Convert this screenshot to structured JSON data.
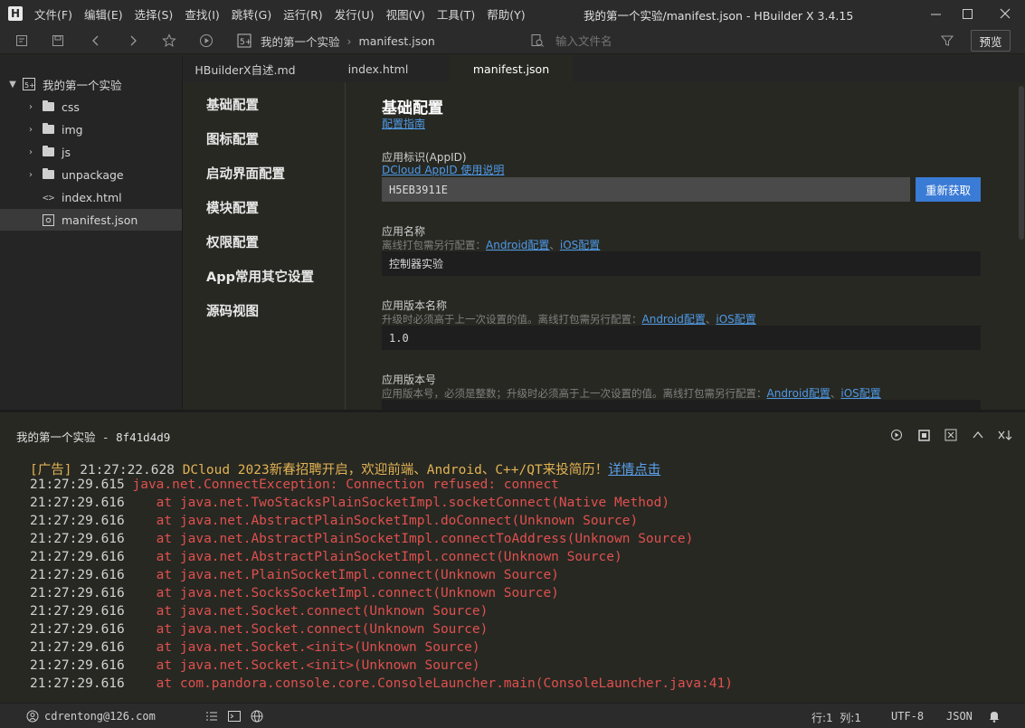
{
  "app": {
    "logo_letter": "H",
    "window_title": "我的第一个实验/manifest.json - HBuilder X 3.4.15",
    "menu": [
      "文件(F)",
      "编辑(E)",
      "选择(S)",
      "查找(I)",
      "跳转(G)",
      "运行(R)",
      "发行(U)",
      "视图(V)",
      "工具(T)",
      "帮助(Y)"
    ]
  },
  "toolbar": {
    "breadcrumb_project": "我的第一个实验",
    "breadcrumb_file": "manifest.json",
    "file_search_placeholder": "输入文件名",
    "preview_label": "预览"
  },
  "sidebar": {
    "project_name": "我的第一个实验",
    "items": [
      {
        "label": "css",
        "type": "folder"
      },
      {
        "label": "img",
        "type": "folder"
      },
      {
        "label": "js",
        "type": "folder"
      },
      {
        "label": "unpackage",
        "type": "folder"
      },
      {
        "label": "index.html",
        "type": "file"
      },
      {
        "label": "manifest.json",
        "type": "file",
        "selected": true
      }
    ]
  },
  "tabs": [
    {
      "label": "HBuilderX自述.md"
    },
    {
      "label": "index.html"
    },
    {
      "label": "manifest.json",
      "active": true
    }
  ],
  "config_nav": [
    "基础配置",
    "图标配置",
    "启动界面配置",
    "模块配置",
    "权限配置",
    "App常用其它设置",
    "源码视图"
  ],
  "form": {
    "title": "基础配置",
    "guide_link": "配置指南",
    "appid_label": "应用标识(AppID)",
    "appid_link": "DCloud AppID 使用说明",
    "appid_value": "H5EB3911E",
    "refresh_label": "重新获取",
    "name_label": "应用名称",
    "name_hint": "离线打包需另行配置：",
    "android_link": "Android配置",
    "sep": "、",
    "ios_link": "iOS配置",
    "name_value": "控制器实验",
    "version_name_label": "应用版本名称",
    "version_name_hint": "升级时必须高于上一次设置的值。离线打包需另行配置：",
    "version_name_value": "1.0",
    "version_code_label": "应用版本号",
    "version_code_hint": "应用版本号，必须是整数；升级时必须高于上一次设置的值。离线打包需另行配置："
  },
  "console": {
    "tab_label": "我的第一个实验 - 8f41d4d9",
    "ad_prefix": "[广告]",
    "ad_time": " 21:27:22.628 ",
    "ad_text": "DCloud 2023新春招聘开启，欢迎前端、Android、C++/QT来投简历！",
    "ad_link": "详情点击",
    "lines": [
      {
        "time": "21:27:29.615",
        "text": " java.net.ConnectException: Connection refused: connect"
      },
      {
        "time": "21:27:29.616",
        "text": "    at java.net.TwoStacksPlainSocketImpl.socketConnect(Native Method)"
      },
      {
        "time": "21:27:29.616",
        "text": "    at java.net.AbstractPlainSocketImpl.doConnect(Unknown Source)"
      },
      {
        "time": "21:27:29.616",
        "text": "    at java.net.AbstractPlainSocketImpl.connectToAddress(Unknown Source)"
      },
      {
        "time": "21:27:29.616",
        "text": "    at java.net.AbstractPlainSocketImpl.connect(Unknown Source)"
      },
      {
        "time": "21:27:29.616",
        "text": "    at java.net.PlainSocketImpl.connect(Unknown Source)"
      },
      {
        "time": "21:27:29.616",
        "text": "    at java.net.SocksSocketImpl.connect(Unknown Source)"
      },
      {
        "time": "21:27:29.616",
        "text": "    at java.net.Socket.connect(Unknown Source)"
      },
      {
        "time": "21:27:29.616",
        "text": "    at java.net.Socket.connect(Unknown Source)"
      },
      {
        "time": "21:27:29.616",
        "text": "    at java.net.Socket.<init>(Unknown Source)"
      },
      {
        "time": "21:27:29.616",
        "text": "    at java.net.Socket.<init>(Unknown Source)"
      },
      {
        "time": "21:27:29.616",
        "text": "    at com.pandora.console.core.ConsoleLauncher.main(ConsoleLauncher.java:41)"
      }
    ]
  },
  "statusbar": {
    "user": "cdrentong@126.com",
    "position": "行:1  列:1",
    "encoding": "UTF-8",
    "language": "JSON"
  },
  "colors": {
    "accent": "#3a7bd5",
    "error": "#e0504f",
    "ad": "#e2b254",
    "link": "#4f9ae8"
  }
}
